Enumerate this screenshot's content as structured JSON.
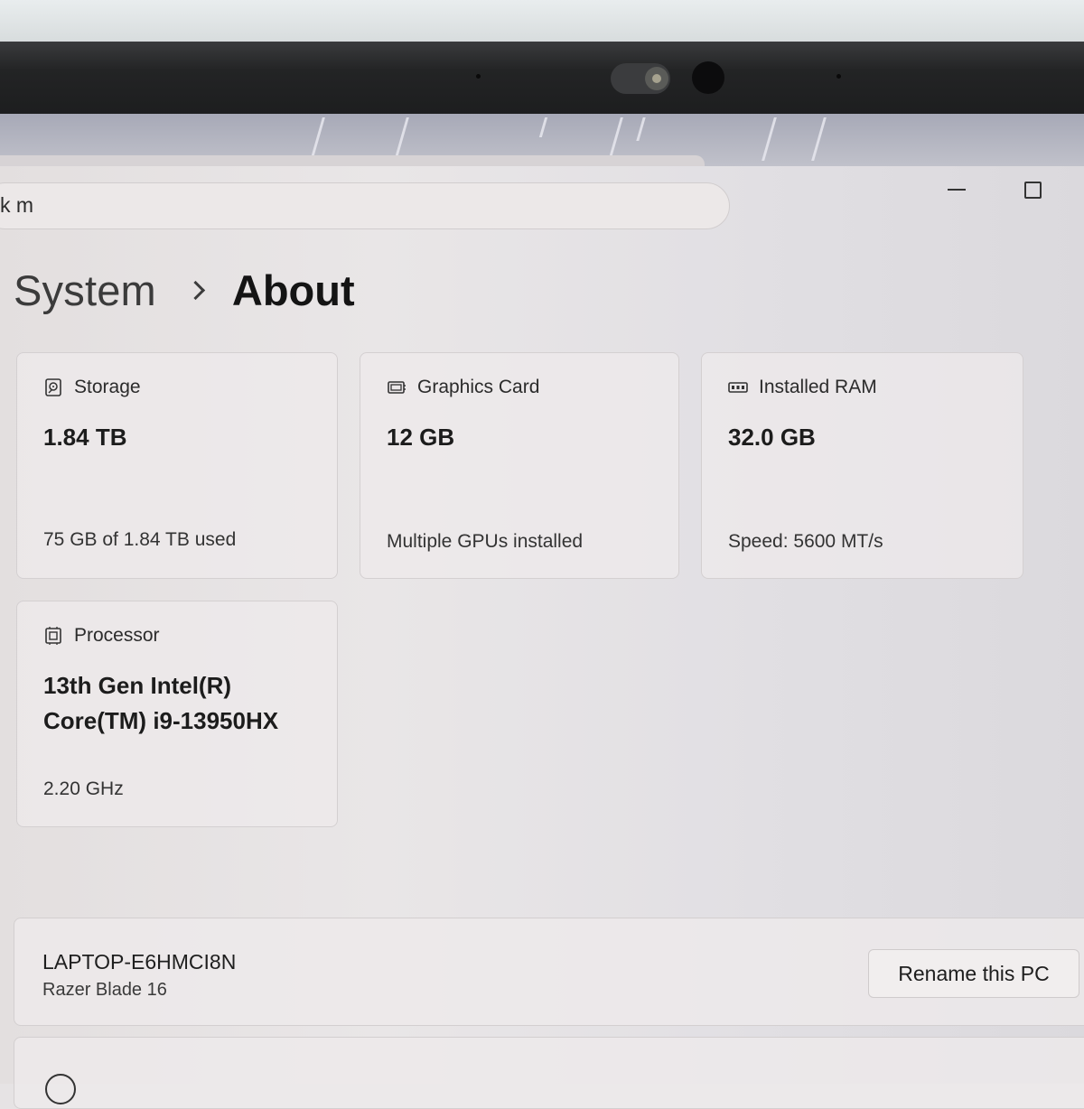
{
  "search": {
    "text": "k m"
  },
  "breadcrumb": {
    "parent": "System",
    "current": "About"
  },
  "cards": {
    "storage": {
      "icon": "storage-icon",
      "label": "Storage",
      "value": "1.84 TB",
      "sub": "75 GB of 1.84 TB used"
    },
    "graphics": {
      "icon": "graphics-card-icon",
      "label": "Graphics Card",
      "value": "12 GB",
      "sub": "Multiple GPUs installed"
    },
    "ram": {
      "icon": "ram-icon",
      "label": "Installed RAM",
      "value": "32.0 GB",
      "sub": "Speed: 5600 MT/s"
    },
    "processor": {
      "icon": "processor-icon",
      "label": "Processor",
      "value_line1": "13th Gen Intel(R)",
      "value_line2": "Core(TM) i9-13950HX",
      "sub": "2.20 GHz"
    }
  },
  "device": {
    "name": "LAPTOP-E6HMCI8N",
    "model": "Razer Blade 16",
    "rename_label": "Rename this PC"
  }
}
